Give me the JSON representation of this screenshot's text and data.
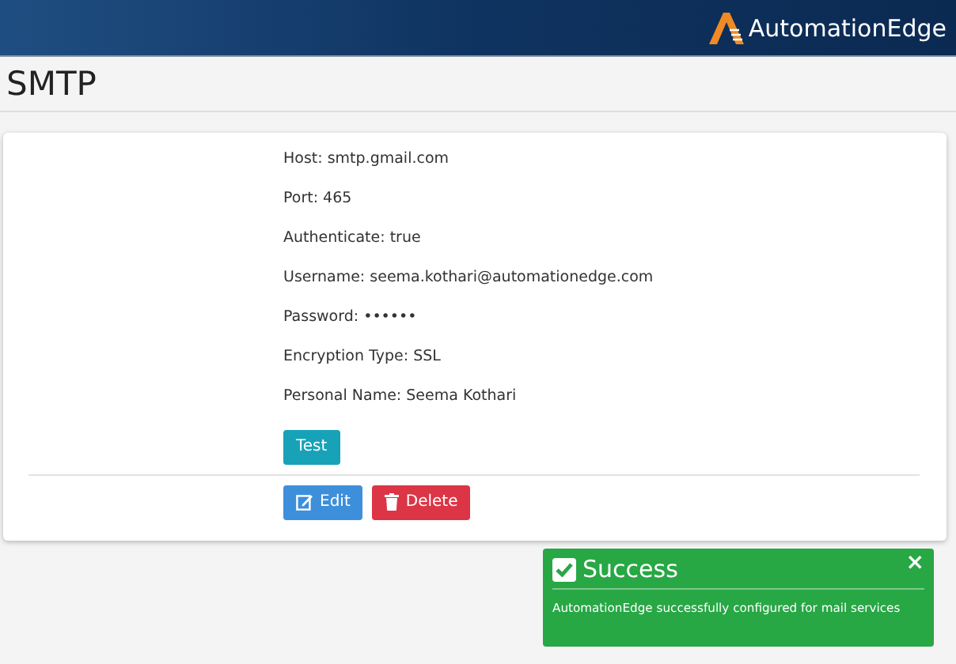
{
  "header": {
    "logo_text": "AutomationEdge"
  },
  "page_title": "SMTP",
  "details": [
    {
      "label": "Host:",
      "value": "smtp.gmail.com"
    },
    {
      "label": "Port:",
      "value": "465"
    },
    {
      "label": "Authenticate:",
      "value": "true"
    },
    {
      "label": "Username:",
      "value": "seema.kothari@automationedge.com"
    },
    {
      "label": "Password:",
      "value": "••••••"
    },
    {
      "label": "Encryption Type:",
      "value": "SSL"
    },
    {
      "label": "Personal Name:",
      "value": "Seema Kothari"
    }
  ],
  "test_button": "Test",
  "actions": [
    {
      "label": "Edit",
      "kind": "edit"
    },
    {
      "label": "Delete",
      "kind": "delete"
    }
  ],
  "toast": {
    "title": "Success",
    "message": "AutomationEdge successfully configured for mail services",
    "close": "×"
  }
}
